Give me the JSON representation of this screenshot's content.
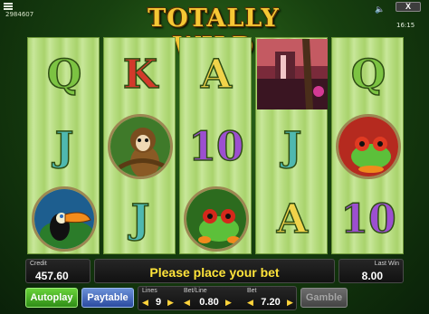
{
  "header": {
    "logo_text": "TOTALLY WILD",
    "game_id": "2984607",
    "clock": "16:15",
    "close_label": "X",
    "sound_icon": "speaker-icon",
    "menu_icon": "menu-icon"
  },
  "reels": [
    [
      "Q",
      "J",
      "toucan"
    ],
    [
      "K",
      "monkey",
      "J"
    ],
    [
      "A",
      "10",
      "frog"
    ],
    [
      "jungle-waterfall",
      "J",
      "A"
    ],
    [
      "Q",
      "frog",
      "10"
    ]
  ],
  "symbol_colors": {
    "Q": "#7cc342",
    "K": "#d23a2b",
    "A": "#f1d34a",
    "J": "#4fb8b0",
    "10": "#9c4fd0"
  },
  "credit": {
    "label": "Credit",
    "value": "457.60"
  },
  "message": "Please place your bet",
  "last_win": {
    "label": "Last Win",
    "value": "8.00"
  },
  "buttons": {
    "autoplay": "Autoplay",
    "paytable": "Paytable",
    "gamble": "Gamble"
  },
  "lines": {
    "label": "Lines",
    "value": "9"
  },
  "bet_line": {
    "label": "Bet/Line",
    "value": "0.80"
  },
  "bet": {
    "label": "Bet",
    "value": "7.20"
  }
}
